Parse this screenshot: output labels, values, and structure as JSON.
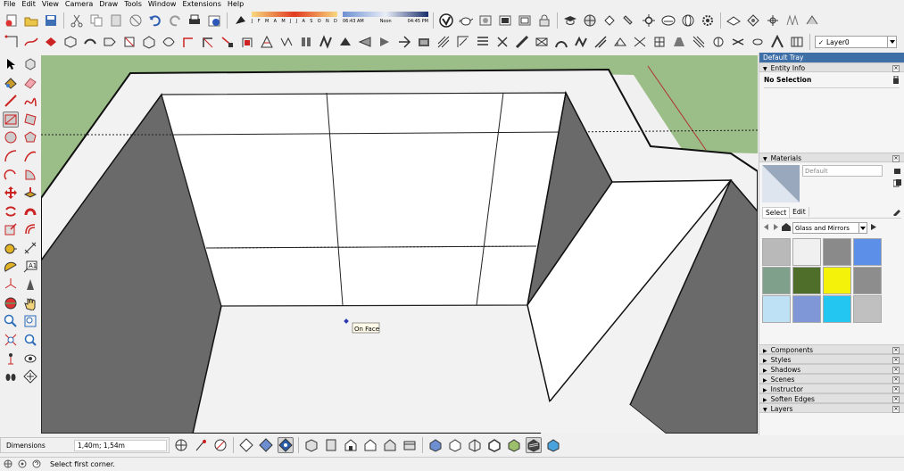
{
  "menu": [
    "File",
    "Edit",
    "View",
    "Camera",
    "Draw",
    "Tools",
    "Window",
    "Extensions",
    "Help"
  ],
  "shadows": {
    "months": [
      "J",
      "F",
      "M",
      "A",
      "M",
      "J",
      "J",
      "A",
      "S",
      "O",
      "N",
      "D"
    ],
    "time_start": "06:43 AM",
    "time_mid": "Noon",
    "time_end": "04:45 PM"
  },
  "layer": {
    "current": "Layer0",
    "check": "✓"
  },
  "viewport": {
    "tooltip": "On Face",
    "sky": "#f0f0f0",
    "ground": "#9bbd87"
  },
  "tray": {
    "title": "Default Tray",
    "entity": {
      "title": "Entity Info",
      "value": "No Selection"
    },
    "materials": {
      "title": "Materials",
      "name_field": "Default",
      "tab_select": "Select",
      "tab_edit": "Edit",
      "library": "Glass and Mirrors",
      "swatches": [
        "#b9b9b9",
        "#f0f0f0",
        "#8a8a8a",
        "#5b8fe8",
        "#7fa08a",
        "#4f6e2a",
        "#f4f10b",
        "#8d8d8d",
        "#bfe1f5",
        "#7f97d6",
        "#22c6f0",
        "#c0c0c0"
      ]
    },
    "panels": [
      "Components",
      "Styles",
      "Shadows",
      "Scenes",
      "Instructor",
      "Soften Edges",
      "Layers"
    ]
  },
  "vcb": {
    "label": "Dimensions",
    "value": "1,40m; 1,54m"
  },
  "status": {
    "hint": "Select first corner."
  }
}
